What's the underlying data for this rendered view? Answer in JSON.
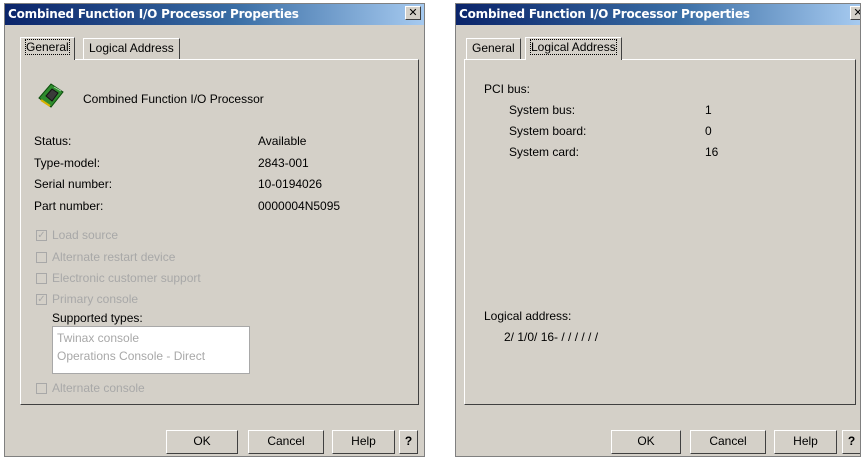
{
  "dialog1": {
    "title": "Combined Function I/O Processor Properties",
    "close_glyph": "✕",
    "tabs": [
      {
        "label": "General"
      },
      {
        "label": "Logical Address"
      }
    ],
    "device_icon": "processor-card-icon",
    "device_name": "Combined Function I/O Processor",
    "properties": [
      {
        "label": "Status:",
        "value": "Available"
      },
      {
        "label": "Type-model:",
        "value": "2843-001"
      },
      {
        "label": "Serial number:",
        "value": "10-0194026"
      },
      {
        "label": "Part number:",
        "value": "0000004N5095"
      }
    ],
    "checkboxes": [
      {
        "label": "Load source",
        "checked": true
      },
      {
        "label": "Alternate restart device",
        "checked": false
      },
      {
        "label": "Electronic customer support",
        "checked": false
      },
      {
        "label": "Primary console",
        "checked": true
      }
    ],
    "supported_types_label": "Supported types:",
    "supported_types": [
      "Twinax console",
      "Operations Console - Direct"
    ],
    "alternate_console": {
      "label": "Alternate console",
      "checked": false
    },
    "buttons": {
      "ok": "OK",
      "cancel": "Cancel",
      "help": "Help",
      "whats_this": "?"
    }
  },
  "dialog2": {
    "title": "Combined Function I/O Processor Properties",
    "close_glyph": "✕",
    "tabs": [
      {
        "label": "General"
      },
      {
        "label": "Logical Address"
      }
    ],
    "pci_bus_label": "PCI bus:",
    "pci_fields": [
      {
        "label": "System bus:",
        "value": "1"
      },
      {
        "label": "System board:",
        "value": "0"
      },
      {
        "label": "System card:",
        "value": "16"
      }
    ],
    "logical_address_label": "Logical address:",
    "logical_address_value": "2/ 1/0/ 16- / / / / / /",
    "buttons": {
      "ok": "OK",
      "cancel": "Cancel",
      "help": "Help",
      "whats_this": "?"
    }
  },
  "colors": {
    "title_start": "#0a246a",
    "title_end": "#a6caf0",
    "face": "#d4d0c8",
    "disabled_text": "#a8a8a8"
  }
}
